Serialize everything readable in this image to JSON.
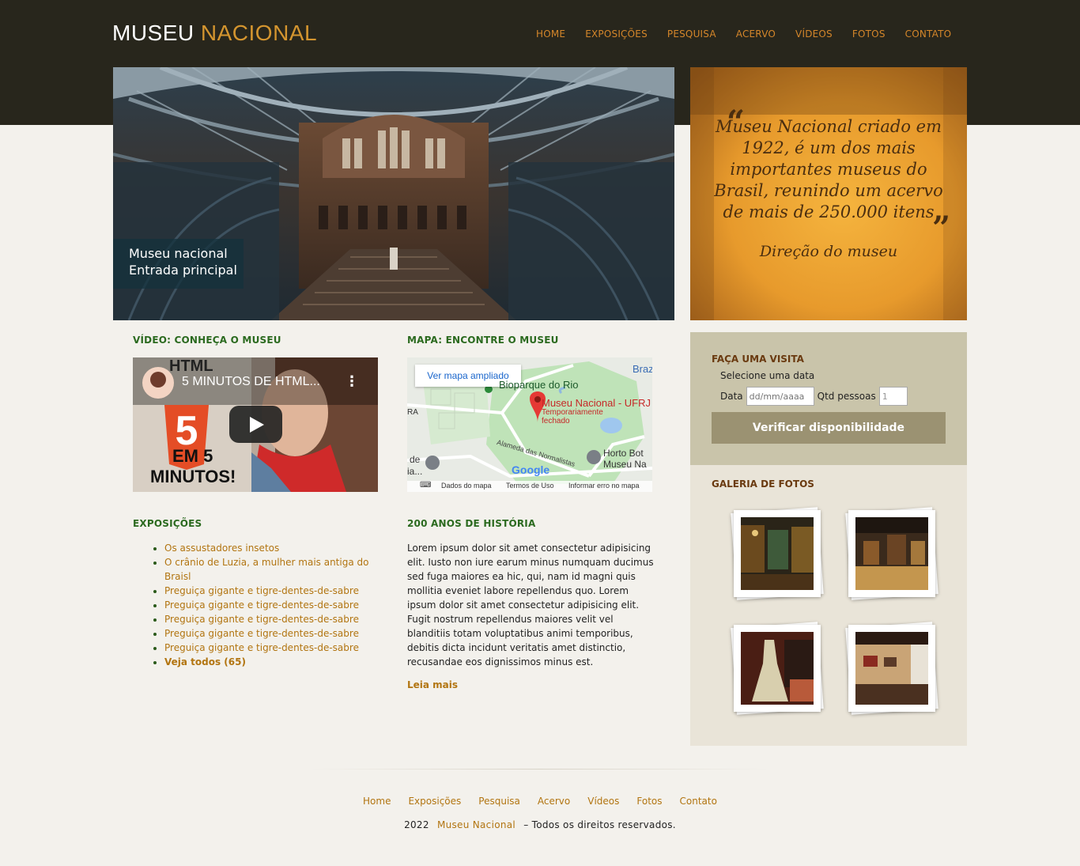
{
  "header": {
    "logo_part1": "MUSEU",
    "logo_part2": "NACIONAL",
    "nav": [
      "HOME",
      "EXPOSIÇÕES",
      "PESQUISA",
      "ACERVO",
      "VÍDEOS",
      "FOTOS",
      "CONTATO"
    ]
  },
  "hero": {
    "caption_line1": "Museu nacional",
    "caption_line2": "Entrada principal"
  },
  "quote": {
    "text": "Museu Nacional criado em 1922, é um dos mais importantes museus do Brasil, reunindo um acervo de mais de 250.000 itens",
    "author": "Direção do museu",
    "open_mark": "“",
    "close_mark": "”"
  },
  "video_section": {
    "title": "VÍDEO: CONHEÇA O MUSEU",
    "video_title": "5 MINUTOS DE HTML...",
    "thumb_text_1": "HTML",
    "thumb_text_2": "EM 5",
    "thumb_text_3": "MINUTOS!"
  },
  "map_section": {
    "title": "MAPA: ENCONTRE O MUSEU",
    "button": "Ver mapa ampliado",
    "labels": {
      "park": "Bioparque do Rio",
      "museum": "Museu Nacional - UFRJ",
      "status": "Temporariamente fechado",
      "street": "Alameda das Normalistas",
      "garden": "Horto Bot",
      "garden2": "Museu Na",
      "brazil": "Braz",
      "ra": "RA",
      "de": "de",
      "ia": "ia...",
      "google": "Google"
    },
    "footer": [
      "Dados do mapa",
      "Termos de Uso",
      "Informar erro no mapa"
    ]
  },
  "exhibitions": {
    "title": "EXPOSIÇÕES",
    "items": [
      "Os assustadores insetos",
      "O crânio de Luzia, a mulher mais antiga do Braisl",
      "Preguiça gigante e tigre-dentes-de-sabre",
      "Preguiça gigante e tigre-dentes-de-sabre",
      "Preguiça gigante e tigre-dentes-de-sabre",
      "Preguiça gigante e tigre-dentes-de-sabre",
      "Preguiça gigante e tigre-dentes-de-sabre"
    ],
    "see_all": "Veja todos (65)"
  },
  "history": {
    "title": "200 ANOS DE HISTÓRIA",
    "body": "Lorem ipsum dolor sit amet consectetur adipisicing elit. Iusto non iure earum minus numquam ducimus sed fuga maiores ea hic, qui, nam id magni quis mollitia eveniet labore repellendus quo. Lorem ipsum dolor sit amet consectetur adipisicing elit. Fugit nostrum repellendus maiores velit vel blanditiis totam voluptatibus animi temporibus, debitis dicta incidunt veritatis amet distinctio, recusandae eos dignissimos minus est.",
    "read_more": "Leia mais"
  },
  "visit": {
    "title": "FAÇA UMA VISITA",
    "hint": "Selecione uma data",
    "date_label": "Data",
    "date_placeholder": "dd/mm/aaaa",
    "people_label": "Qtd pessoas",
    "people_value": "1",
    "button": "Verificar disponibilidade"
  },
  "gallery": {
    "title": "GALERIA DE FOTOS"
  },
  "footer": {
    "nav": [
      "Home",
      "Exposições",
      "Pesquisa",
      "Acervo",
      "Vídeos",
      "Fotos",
      "Contato"
    ],
    "year": "2022",
    "site": "Museu Nacional",
    "rights": "– Todos os direitos reservados."
  }
}
